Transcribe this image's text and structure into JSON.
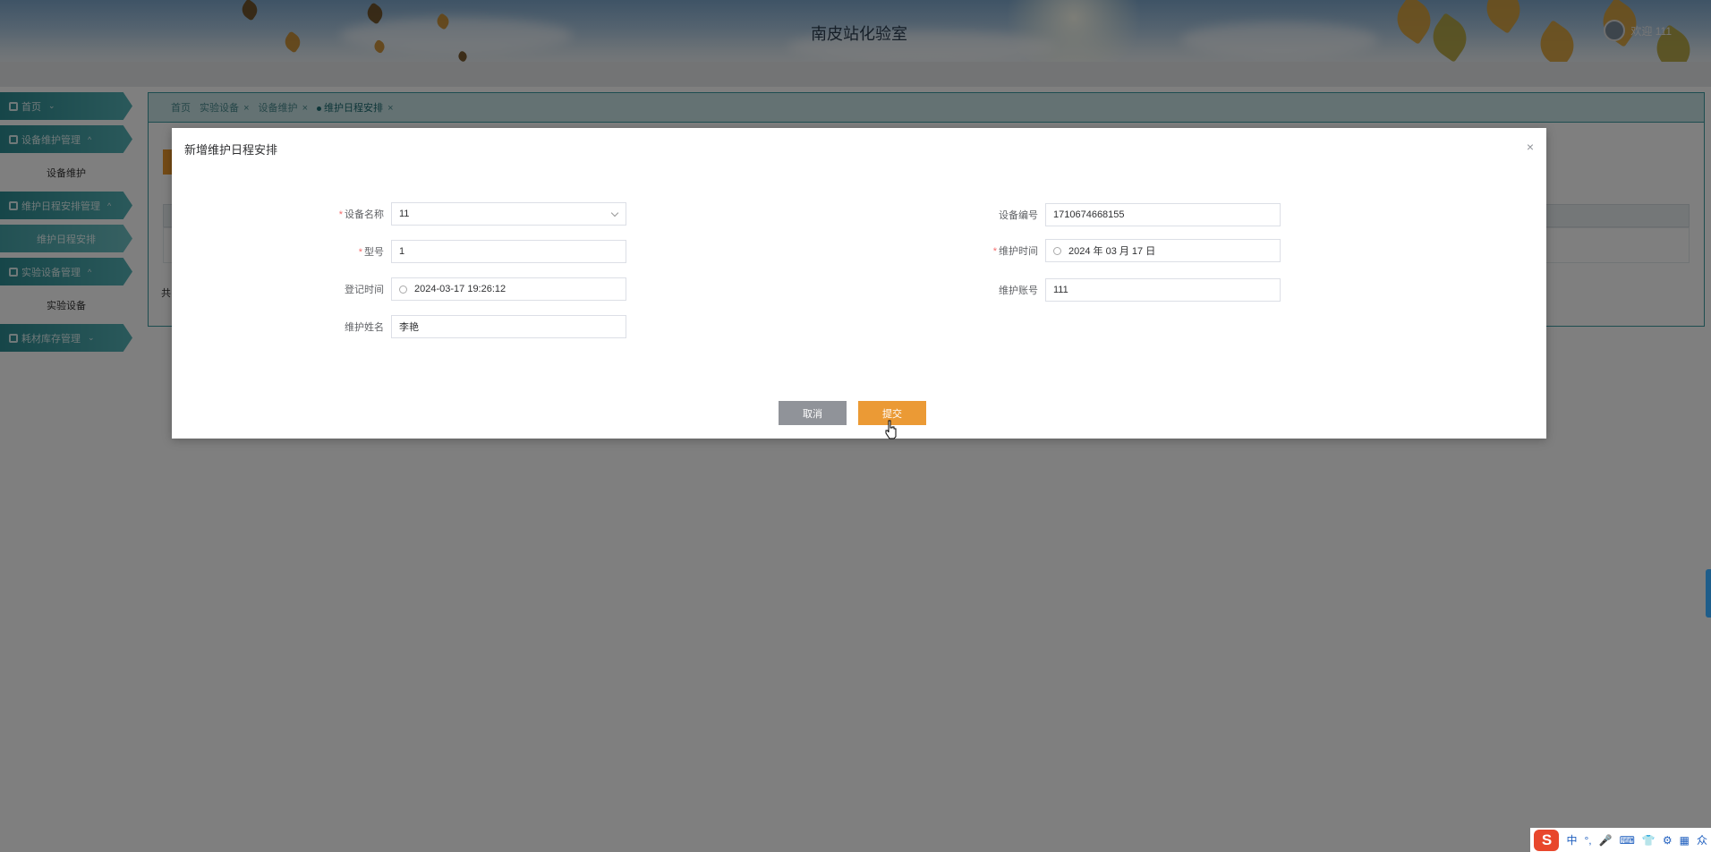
{
  "header": {
    "title": "南皮站化验室",
    "welcome": "欢迎 111"
  },
  "sidebar": {
    "items": [
      {
        "label": "首页",
        "type": "menu"
      },
      {
        "label": "设备维护管理",
        "type": "menu"
      },
      {
        "label": "设备维护",
        "type": "sub"
      },
      {
        "label": "维护日程安排管理",
        "type": "menu"
      },
      {
        "label": "维护日程安排",
        "type": "sub-active"
      },
      {
        "label": "实验设备管理",
        "type": "menu"
      },
      {
        "label": "实验设备",
        "type": "sub"
      },
      {
        "label": "耗材库存管理",
        "type": "menu"
      }
    ]
  },
  "breadcrumb": {
    "items": [
      "首页",
      "实验设备",
      "设备维护",
      "维护日程安排"
    ]
  },
  "main": {
    "footer_text": "共"
  },
  "dialog": {
    "title": "新增维护日程安排",
    "close": "×",
    "fields": {
      "equipment_name": {
        "label": "设备名称",
        "value": "11",
        "required": true
      },
      "model": {
        "label": "型号",
        "value": "1",
        "required": true
      },
      "register_time": {
        "label": "登记时间",
        "value": "2024-03-17 19:26:12"
      },
      "maintainer_name": {
        "label": "维护姓名",
        "value": "李艳"
      },
      "equipment_no": {
        "label": "设备编号",
        "value": "1710674668155"
      },
      "maintenance_time": {
        "label": "维护时间",
        "value": "2024 年 03 月 17 日",
        "required": true
      },
      "maintainer_account": {
        "label": "维护账号",
        "value": "111"
      }
    },
    "cancel_label": "取消",
    "submit_label": "提交"
  },
  "ime": {
    "items": [
      "中",
      "°,",
      "🎤",
      "⌨",
      "👕",
      "⚙",
      "▦",
      "众"
    ]
  },
  "colors": {
    "accent_teal": "#3a9aa0",
    "submit_orange": "#eb9a35",
    "cancel_gray": "#909399"
  }
}
